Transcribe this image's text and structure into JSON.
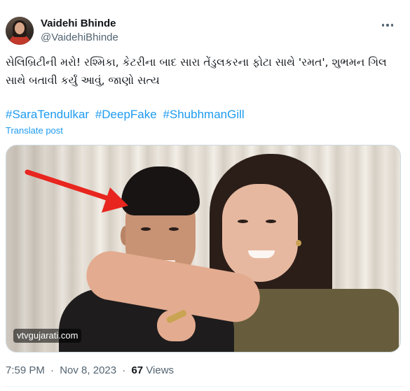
{
  "author": {
    "display_name": "Vaidehi Bhinde",
    "handle": "@VaidehiBhinde"
  },
  "tweet": {
    "text": "સેલિબ્રિટીની મરો! રશ્મિકા, કેટરીના બાદ સારા તેંડુલકરના ફોટા સાથે 'રમત', શુભમન ગિલ સાથે બતાવી કર્યું આવું, જાણો સત્ય",
    "hashtags": [
      "#SaraTendulkar",
      "#DeepFake",
      "#ShubhmanGill"
    ],
    "translate_label": "Translate post"
  },
  "media": {
    "watermark": "vtvgujarati.com",
    "arrow_color": "#e8251f"
  },
  "meta": {
    "time": "7:59 PM",
    "date": "Nov 8, 2023",
    "separator": "·",
    "views_count": "67",
    "views_label": "Views"
  },
  "icons": {
    "more": "more-horizontal-icon"
  },
  "colors": {
    "link": "#1d9bf0",
    "secondary_text": "#536471",
    "primary_text": "#0f1419"
  }
}
